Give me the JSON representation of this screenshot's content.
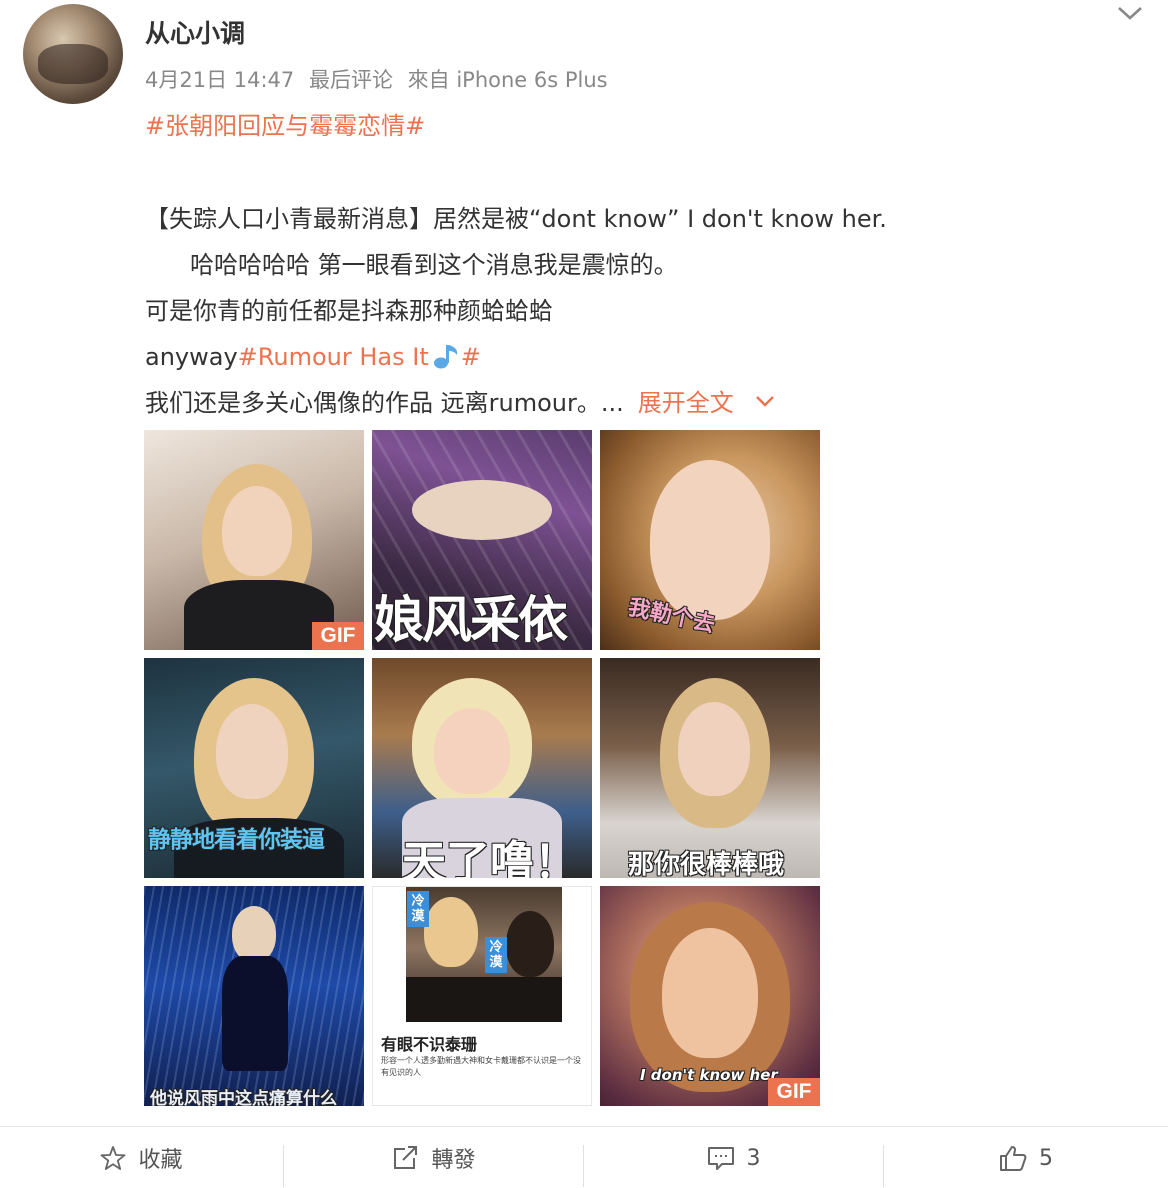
{
  "post": {
    "username": "从心小调",
    "meta": {
      "date": "4月21日 14:47",
      "comment_label": "最后评论",
      "source": "來自 iPhone 6s Plus"
    },
    "topic_tag": "#张朝阳回应与霉霉恋情#",
    "lines": {
      "line1": "【失踪人口小青最新消息】居然是被“dont know” I don't know her.",
      "line2": "哈哈哈哈哈 第一眼看到这个消息我是震惊的。",
      "line3": "可是你青的前任都是抖森那种颜蛤蛤蛤",
      "line4_prefix": "anyway",
      "line4_tag": "#Rumour Has It",
      "line4_hash": "#",
      "line5": "我们还是多关心偶像的作品 远离rumour。..."
    },
    "expand_label": "展开全文",
    "images": {
      "badge": "GIF",
      "cap2": "娘风采依",
      "cap3": "我勒个去",
      "cap4": "静静地看着你装逼",
      "cap5": "天了噜！",
      "cap6": "那你很棒棒哦",
      "cap7": "他说风雨中这点痛算什么",
      "cap8_tag1": "冷漠",
      "cap8_tag2": "冷漠",
      "cap8_title": "有眼不识泰珊",
      "cap8_desc": "形容一个人透多勤新遇大神和女卡戴珊都不认识是一个没有见识的人",
      "cap9": "I don't know her"
    }
  },
  "footer": {
    "favorite_label": "收藏",
    "repost_label": "轉發",
    "comment_count": "3",
    "like_count": "5"
  },
  "colors": {
    "accent": "#eb7350",
    "text": "#333333",
    "meta": "#888888"
  }
}
